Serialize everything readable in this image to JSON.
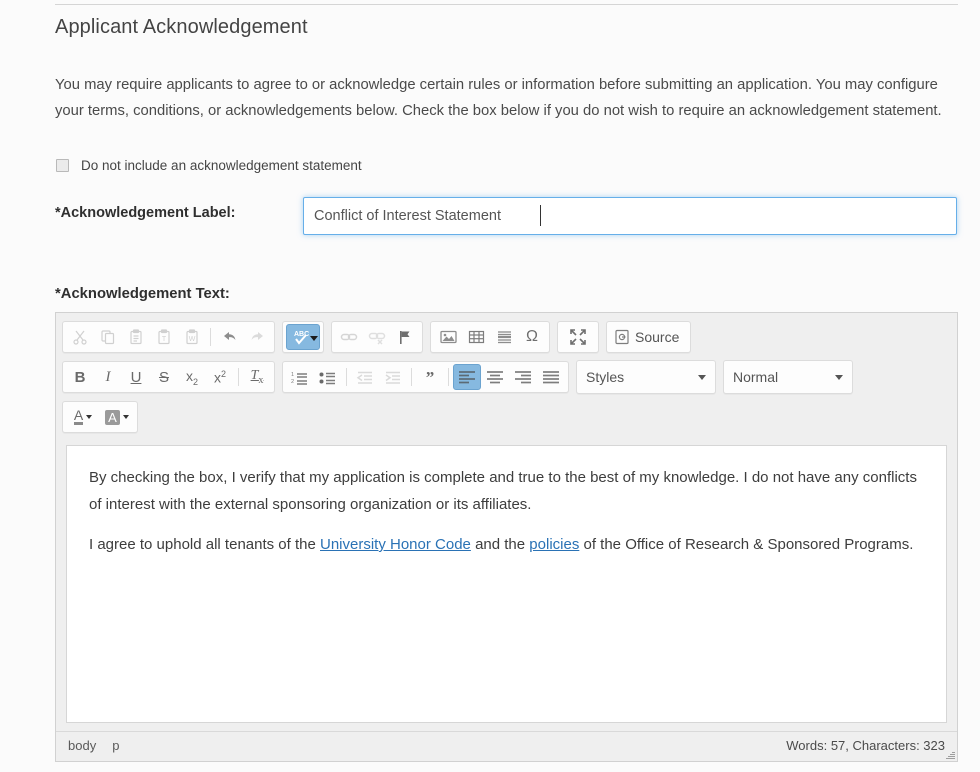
{
  "section": {
    "title": "Applicant Acknowledgement",
    "intro": "You may require applicants to agree to or acknowledge certain rules or information before submitting an application. You may configure your terms, conditions, or acknowledgements below. Check the box below if you do not wish to require an acknowledgement statement.",
    "checkbox_label": "Do not include an acknowledgement statement",
    "checkbox_checked": "false"
  },
  "fields": {
    "label_caption": "*Acknowledgement Label:",
    "label_value": "Conflict of Interest Statement",
    "label_placeholder": "",
    "text_caption": "*Acknowledgement Text:"
  },
  "editor": {
    "toolbar_row1": [
      {
        "name": "cut",
        "title": "Cut",
        "state": "disabled"
      },
      {
        "name": "copy",
        "title": "Copy",
        "state": "disabled"
      },
      {
        "name": "paste",
        "title": "Paste",
        "state": "disabled"
      },
      {
        "name": "paste-text",
        "title": "Paste as plain text",
        "state": "disabled"
      },
      {
        "name": "paste-word",
        "title": "Paste from Word",
        "state": "disabled"
      },
      {
        "name": "undo",
        "title": "Undo",
        "state": "normal"
      },
      {
        "name": "redo",
        "title": "Redo",
        "state": "disabled"
      },
      {
        "name": "spellcheck",
        "title": "Spell Check As You Type",
        "state": "active"
      },
      {
        "name": "link",
        "title": "Link",
        "state": "disabled"
      },
      {
        "name": "unlink",
        "title": "Unlink",
        "state": "disabled"
      },
      {
        "name": "anchor",
        "title": "Anchor",
        "state": "normal"
      },
      {
        "name": "image",
        "title": "Image",
        "state": "normal"
      },
      {
        "name": "table",
        "title": "Table",
        "state": "normal"
      },
      {
        "name": "horizontal-rule",
        "title": "Insert Horizontal Line",
        "state": "normal"
      },
      {
        "name": "special-char",
        "title": "Insert Special Character",
        "state": "normal"
      },
      {
        "name": "maximize",
        "title": "Maximize",
        "state": "normal"
      },
      {
        "name": "source",
        "title": "Source",
        "state": "normal"
      }
    ],
    "source_label": "Source",
    "toolbar_row2": [
      {
        "name": "bold",
        "title": "Bold"
      },
      {
        "name": "italic",
        "title": "Italic"
      },
      {
        "name": "underline",
        "title": "Underline"
      },
      {
        "name": "strike",
        "title": "Strikethrough"
      },
      {
        "name": "subscript",
        "title": "Subscript"
      },
      {
        "name": "superscript",
        "title": "Superscript"
      },
      {
        "name": "remove-format",
        "title": "Remove Format"
      },
      {
        "name": "numbered-list",
        "title": "Insert/Remove Numbered List"
      },
      {
        "name": "bulleted-list",
        "title": "Insert/Remove Bulleted List"
      },
      {
        "name": "outdent",
        "title": "Decrease Indent"
      },
      {
        "name": "indent",
        "title": "Increase Indent"
      },
      {
        "name": "blockquote",
        "title": "Block Quote"
      },
      {
        "name": "align-left",
        "title": "Align Left"
      },
      {
        "name": "align-center",
        "title": "Center"
      },
      {
        "name": "align-right",
        "title": "Align Right"
      },
      {
        "name": "justify",
        "title": "Justify"
      }
    ],
    "styles_dropdown": "Styles",
    "format_dropdown": "Normal",
    "toolbar_row3": [
      {
        "name": "text-color",
        "title": "Text Color"
      },
      {
        "name": "background-color",
        "title": "Background Color"
      }
    ],
    "content": {
      "paragraph1": "By checking the box, I verify that my application is complete and true to the best of my knowledge. I do not have any conflicts of interest with the external sponsoring organization or its affiliates.",
      "paragraph2_pre": "I agree to uphold all tenants of the ",
      "paragraph2_link1": "University Honor Code",
      "paragraph2_mid": " and the ",
      "paragraph2_link2": "policies",
      "paragraph2_post": " of the Office of Research & Sponsored Programs."
    },
    "status": {
      "element_path_1": "body",
      "element_path_2": "p",
      "word_count": "Words: 57, Characters: 323"
    }
  },
  "colors": {
    "accent": "#86b9e0",
    "focus_border": "#66afe9",
    "link": "#2a72b5",
    "toolbar_bg": "#efefef"
  }
}
